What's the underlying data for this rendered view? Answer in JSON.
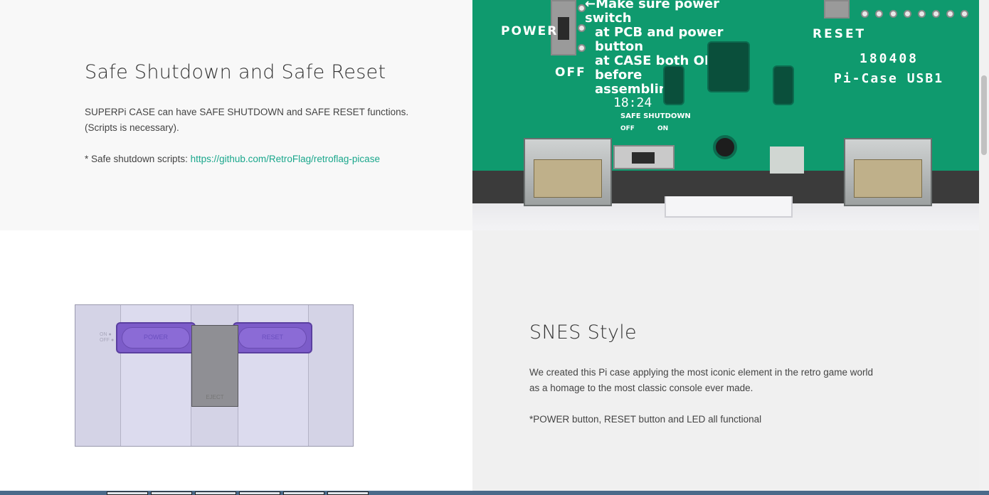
{
  "section1": {
    "title": "Safe Shutdown and Safe Reset",
    "paragraph": "SUPERPi CASE can have SAFE SHUTDOWN and SAFE RESET functions. (Scripts is necessary).",
    "scripts_prefix": "* Safe shutdown scripts: ",
    "scripts_link": "https://github.com/RetroFlag/retroflag-picase"
  },
  "pcb_image": {
    "power_label": "POWER",
    "off_label": "OFF",
    "reset_label": "RESET",
    "warning_lines": [
      "←Make sure power switch",
      "at PCB and power button",
      "at CASE both OFF before",
      "assembling."
    ],
    "board_date": "180408",
    "board_name": "Pi-Case USB1",
    "time_label": "18:24",
    "safe_shutdown_label": "SAFE  SHUTDOWN",
    "switch_off": "OFF",
    "switch_on": "ON"
  },
  "section2": {
    "title": "SNES Style",
    "paragraph": "We created this Pi case applying the most iconic element in the retro game world as a homage to the most classic console ever made.",
    "note": "*POWER button, RESET button and LED all functional"
  },
  "case_image": {
    "power_btn": "POWER",
    "reset_btn": "RESET",
    "eject_label": "EJECT",
    "led_label": "ON ●\nOFF ●"
  },
  "colors": {
    "link": "#1aa78c",
    "pcb_green": "#0f9a6e",
    "case_purple": "#7c5cc9"
  }
}
